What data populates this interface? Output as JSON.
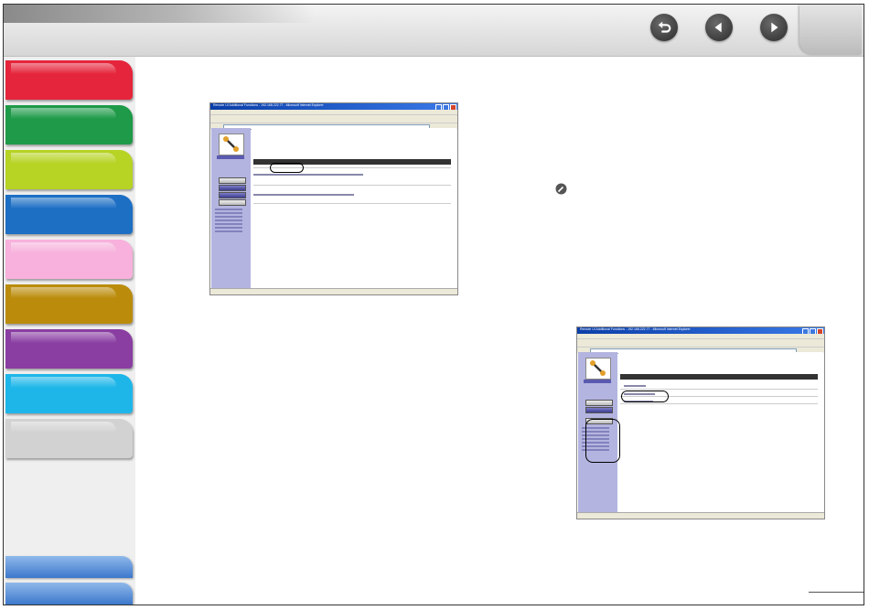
{
  "header": {
    "nav": {
      "back_icon": "return-arrow-icon",
      "prev_icon": "triangle-left-icon",
      "next_icon": "triangle-right-icon"
    }
  },
  "sidebar": {
    "tab_colors": [
      "#e5253b",
      "#1e9a48",
      "#b7d324",
      "#1d6fc4",
      "#f7b1dc",
      "#bb8c0c",
      "#8a3ea2",
      "#1eb6e9",
      "#d2d2d2"
    ]
  },
  "screenshots": {
    "left": {
      "window_title": "Remote UI Additional Functions - 192.168.222.77 - Microsoft Internet Explorer",
      "inner_title": "Import/Export: Import/Export Data",
      "line1": "Click [Import] / [Export] the file to User Management.",
      "line2": "Click [Next Export] to export the files to User Management."
    },
    "right": {
      "window_title": "Remote UI Additional Functions - 192.168.222.77 - Microsoft Internet Explorer",
      "inner_title": "Import/Export",
      "item1": "Address Book",
      "item2": "User Management Data",
      "item3": "Additional Functions"
    }
  }
}
